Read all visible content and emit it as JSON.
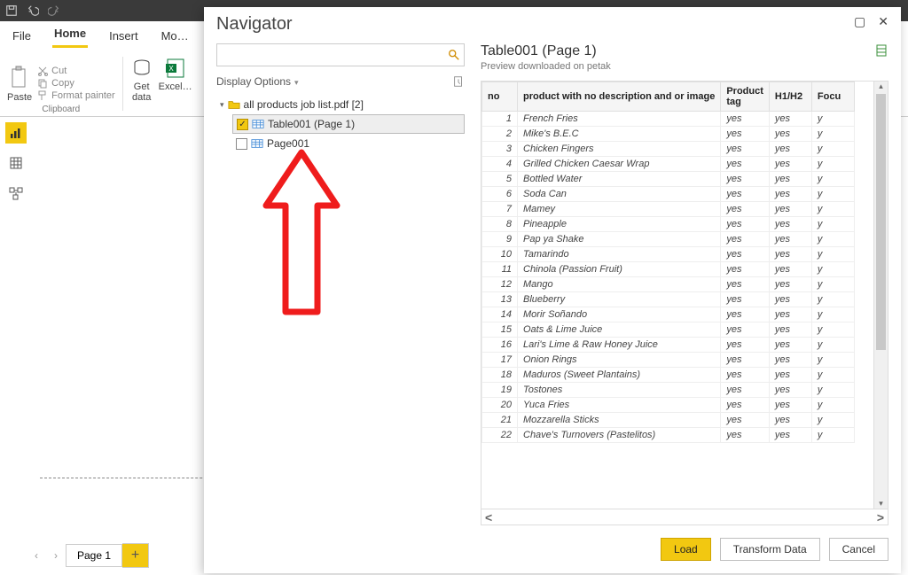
{
  "menu": {
    "file": "File",
    "home": "Home",
    "insert": "Insert",
    "modeling": "Mo…"
  },
  "ribbon": {
    "paste": "Paste",
    "cut": "Cut",
    "copy": "Copy",
    "format": "Format painter",
    "clipboard": "Clipboard",
    "getdata": "Get\ndata",
    "getdata_arrow": "▾",
    "excel": "Excel…"
  },
  "pagetab": {
    "name": "Page 1"
  },
  "navigator": {
    "title": "Navigator",
    "search_placeholder": "",
    "display_options": "Display Options",
    "folder": "all products job list.pdf [2]",
    "items": [
      {
        "label": "Table001 (Page 1)",
        "checked": true,
        "sel": true
      },
      {
        "label": "Page001",
        "checked": false,
        "sel": false
      }
    ],
    "preview_title": "Table001 (Page 1)",
    "preview_sub": "Preview downloaded on petak",
    "columns": [
      "no",
      "product with no description and or image",
      "Product tag",
      "H1/H2",
      "Focu"
    ],
    "rows": [
      {
        "no": 1,
        "p": "French Fries"
      },
      {
        "no": 2,
        "p": "Mike's B.E.C"
      },
      {
        "no": 3,
        "p": "Chicken Fingers"
      },
      {
        "no": 4,
        "p": "Grilled Chicken Caesar Wrap"
      },
      {
        "no": 5,
        "p": "Bottled Water"
      },
      {
        "no": 6,
        "p": "Soda Can"
      },
      {
        "no": 7,
        "p": "Mamey"
      },
      {
        "no": 8,
        "p": "Pineapple"
      },
      {
        "no": 9,
        "p": "Pap ya Shake"
      },
      {
        "no": 10,
        "p": "Tamarindo"
      },
      {
        "no": 11,
        "p": "Chinola (Passion Fruit)"
      },
      {
        "no": 12,
        "p": "Mango"
      },
      {
        "no": 13,
        "p": "Blueberry"
      },
      {
        "no": 14,
        "p": "Morir Soñando"
      },
      {
        "no": 15,
        "p": "Oats & Lime Juice"
      },
      {
        "no": 16,
        "p": "Lari's Lime & Raw Honey Juice"
      },
      {
        "no": 17,
        "p": "Onion Rings"
      },
      {
        "no": 18,
        "p": "Maduros (Sweet Plantains)"
      },
      {
        "no": 19,
        "p": "Tostones"
      },
      {
        "no": 20,
        "p": "Yuca Fries"
      },
      {
        "no": 21,
        "p": "Mozzarella Sticks"
      },
      {
        "no": 22,
        "p": "Chave's Turnovers (Pastelitos)"
      }
    ],
    "yes": "yes",
    "y": "y",
    "buttons": {
      "load": "Load",
      "transform": "Transform Data",
      "cancel": "Cancel"
    }
  }
}
